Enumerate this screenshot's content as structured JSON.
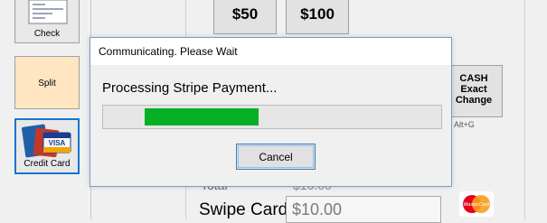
{
  "left_tiles": {
    "check_label": "Check",
    "split_label": "Split",
    "credit_label": "Credit Card"
  },
  "cash_buttons": [
    "$50",
    "$100"
  ],
  "exact_change": {
    "line1": "CASH",
    "line2": "Exact",
    "line3": "Change",
    "shortcut": "Alt+G"
  },
  "footer": {
    "total_label": "Total",
    "total_value": "$10.00",
    "swipe_label": "Swipe Card",
    "amount": "$10.00"
  },
  "dialog": {
    "title": "Communicating.  Please Wait",
    "message": "Processing Stripe Payment...",
    "progress_fraction": 0.33,
    "cancel_label": "Cancel"
  },
  "colors": {
    "progress": "#06b025",
    "accent_border": "#1874d0",
    "split_bg": "#ffe6c0"
  },
  "icons": [
    "check-icon",
    "credit-cards-icon",
    "mastercard-icon"
  ]
}
